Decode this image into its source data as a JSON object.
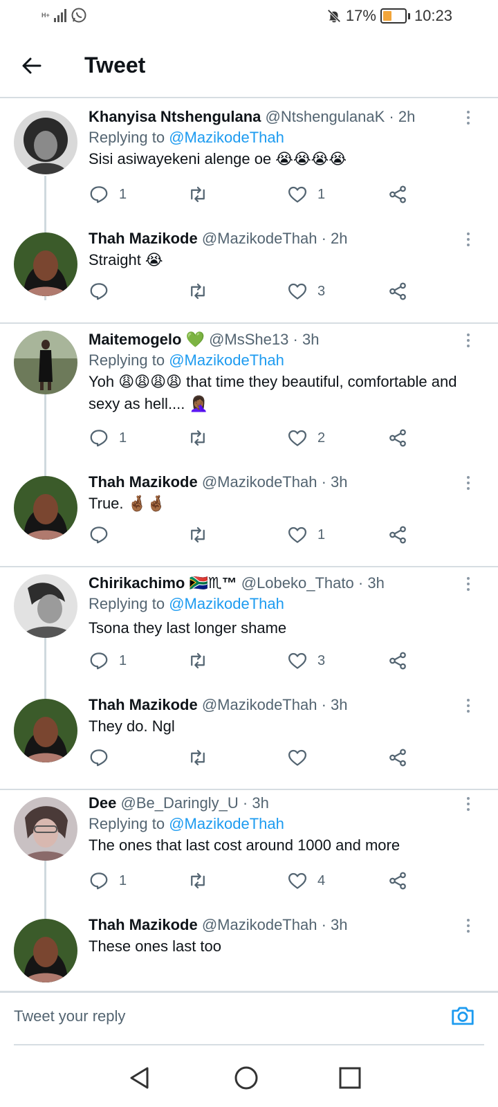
{
  "status_bar": {
    "network": "H+",
    "battery_percent": "17%",
    "battery_level": 0.17,
    "time": "10:23",
    "icons": [
      "signal-icon",
      "whatsapp-icon",
      "mute-bell-icon",
      "battery-icon"
    ]
  },
  "header": {
    "title": "Tweet",
    "back_icon": "arrow-left-icon"
  },
  "colors": {
    "link": "#1d9bf0",
    "muted": "#536471",
    "divider": "#d6dde2",
    "text": "#0f1419"
  },
  "tweets": [
    {
      "name": "Khanyisa Ntshengulana",
      "handle": "@NtshengulanaK",
      "time": "2h",
      "replying_label": "Replying to",
      "replying_to": "@MazikodeThah",
      "text": "Sisi asiwayekeni alenge oe 😭😭😭😭",
      "replies": "1",
      "retweets": "",
      "likes": "1"
    },
    {
      "name": "Thah Mazikode",
      "handle": "@MazikodeThah",
      "time": "2h",
      "text": "Straight 😭",
      "replies": "",
      "retweets": "",
      "likes": "3"
    },
    {
      "name": "Maitemogelo 💚",
      "handle": "@MsShe13",
      "time": "3h",
      "replying_label": "Replying to",
      "replying_to": "@MazikodeThah",
      "text": "Yoh 😩😩😩😩 that time they beautiful, comfortable and sexy as hell.... 🤦🏾‍♀️",
      "replies": "1",
      "retweets": "",
      "likes": "2"
    },
    {
      "name": "Thah Mazikode",
      "handle": "@MazikodeThah",
      "time": "3h",
      "text": "True. 🤞🏾🤞🏾",
      "replies": "",
      "retweets": "",
      "likes": "1"
    },
    {
      "name": "Chirikachimo 🇿🇦♏™",
      "handle": "@Lobeko_Thato",
      "time": "3h",
      "replying_label": "Replying to",
      "replying_to": "@MazikodeThah",
      "text": "Tsona they last longer shame",
      "replies": "1",
      "retweets": "",
      "likes": "3"
    },
    {
      "name": "Thah Mazikode",
      "handle": "@MazikodeThah",
      "time": "3h",
      "text": "They do. Ngl",
      "replies": "",
      "retweets": "",
      "likes": ""
    },
    {
      "name": "Dee",
      "handle": "@Be_Daringly_U",
      "time": "3h",
      "replying_label": "Replying to",
      "replying_to": "@MazikodeThah",
      "text": "The ones that last cost around 1000 and more",
      "replies": "1",
      "retweets": "",
      "likes": "4"
    },
    {
      "name": "Thah Mazikode",
      "handle": "@MazikodeThah",
      "time": "3h",
      "text": "These ones last too"
    }
  ],
  "reply_bar": {
    "placeholder": "Tweet your reply",
    "camera_icon": "camera-icon"
  },
  "nav_bar": {
    "icons": [
      "back-triangle-icon",
      "home-circle-icon",
      "recents-square-icon"
    ]
  }
}
